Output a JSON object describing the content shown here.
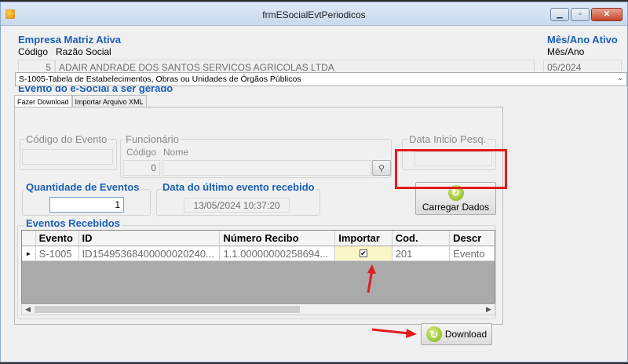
{
  "window": {
    "title": "frmESocialEvtPeriodicos"
  },
  "empresa": {
    "group_title": "Empresa Matriz Ativa",
    "codigo_label": "Código",
    "razao_label": "Razão Social",
    "codigo_value": "5",
    "razao_value": "ADAIR ANDRADE DOS SANTOS SERVICOS AGRICOLAS LTDA"
  },
  "periodo": {
    "group_title": "Mês/Ano Ativo",
    "label": "Mês/Ano",
    "value": "05/2024"
  },
  "evento": {
    "group_title": "Evento do e-Social a ser gerado",
    "selected": "S-1005-Tabela de Estabelecimentos, Obras ou Unidades de Órgãos Públicos"
  },
  "tabs": [
    {
      "label": "Fazer Download",
      "active": true
    },
    {
      "label": "Importar Arquivo XML",
      "active": false
    }
  ],
  "filtros": {
    "codigo_evento_title": "Código do Evento",
    "funcionario_title": "Funcionário",
    "func_codigo_label": "Código",
    "func_nome_label": "Nome",
    "func_codigo_value": "0",
    "data_inicio_title": "Data Inicio Pesq."
  },
  "quantidade": {
    "title": "Quantidade de Eventos",
    "value": "1"
  },
  "ultimo_evento": {
    "title": "Data do último evento recebido",
    "value": "13/05/2024 10:37:20"
  },
  "carregar_button": "Carregar Dados",
  "eventos_recebidos": {
    "title": "Eventos Recebidos",
    "columns": [
      "Evento",
      "ID",
      "Número Recibo",
      "Importar",
      "Cod.",
      "Descr"
    ],
    "rows": [
      {
        "evento": "S-1005",
        "id": "ID15495368400000020240...",
        "recibo": "1.1.00000000258694...",
        "importar": true,
        "cod": "201",
        "descr": "Evento"
      }
    ]
  },
  "download_button": "Download",
  "colors": {
    "accent": "#1a5fb4",
    "highlight": "#e21b1b"
  }
}
